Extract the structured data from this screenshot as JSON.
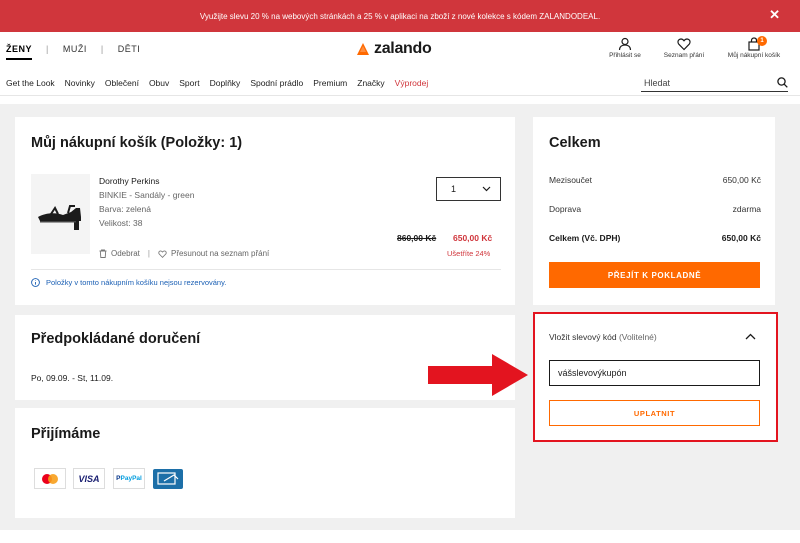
{
  "promo": {
    "text": "Využijte slevu 20 % na webových stránkách a 25 % v aplikaci na zboží z nové kolekce s kódem ZALANDODEAL.",
    "close": "✕"
  },
  "gender_nav": [
    "ŽENY",
    "MUŽI",
    "DĚTI"
  ],
  "logo": {
    "text": "zalando"
  },
  "account": {
    "login": "Přihlásit se",
    "wishlist": "Seznam přání",
    "bag": "Můj nákupní košík",
    "bag_count": "1"
  },
  "categories": [
    "Get the Look",
    "Novinky",
    "Oblečení",
    "Obuv",
    "Sport",
    "Doplňky",
    "Spodní prádlo",
    "Premium",
    "Značky",
    "Výprodej"
  ],
  "search": {
    "placeholder": "Hledat"
  },
  "cart": {
    "title": "Můj nákupní košík (Položky: 1)",
    "item": {
      "brand": "Dorothy Perkins",
      "name": "BINKIE - Sandály - green",
      "color": "Barva: zelená",
      "size": "Velikost: 38",
      "quantity": "1",
      "old_price": "860,00 Kč",
      "new_price": "650,00 Kč",
      "savings": "Ušetříte 24%"
    },
    "remove_label": "Odebrat",
    "move_label": "Přesunout na seznam přání",
    "note": "Položky v tomto nákupním košíku nejsou rezervovány."
  },
  "delivery": {
    "title": "Předpokládané doručení",
    "dates": "Po, 09.09. - St, 11.09."
  },
  "payments": {
    "title": "Přijímáme",
    "methods": [
      "mastercard",
      "VISA",
      "PayPal",
      "card-on-delivery"
    ]
  },
  "total": {
    "title": "Celkem",
    "subtotal_label": "Mezisoučet",
    "subtotal_value": "650,00 Kč",
    "shipping_label": "Doprava",
    "shipping_value": "zdarma",
    "total_label": "Celkem (Vč. DPH)",
    "total_value": "650,00 Kč",
    "checkout_label": "PŘEJÍT K POKLADNĚ"
  },
  "coupon": {
    "label": "Vložit slevový kód",
    "optional": "(Volitelné)",
    "value": "vášslevovýkupón",
    "apply_label": "UPLATNIT"
  },
  "colors": {
    "accent": "#ff6900",
    "promo_bg": "#d0363c",
    "highlight_border": "#e3141f",
    "arrow": "#e3141f"
  }
}
